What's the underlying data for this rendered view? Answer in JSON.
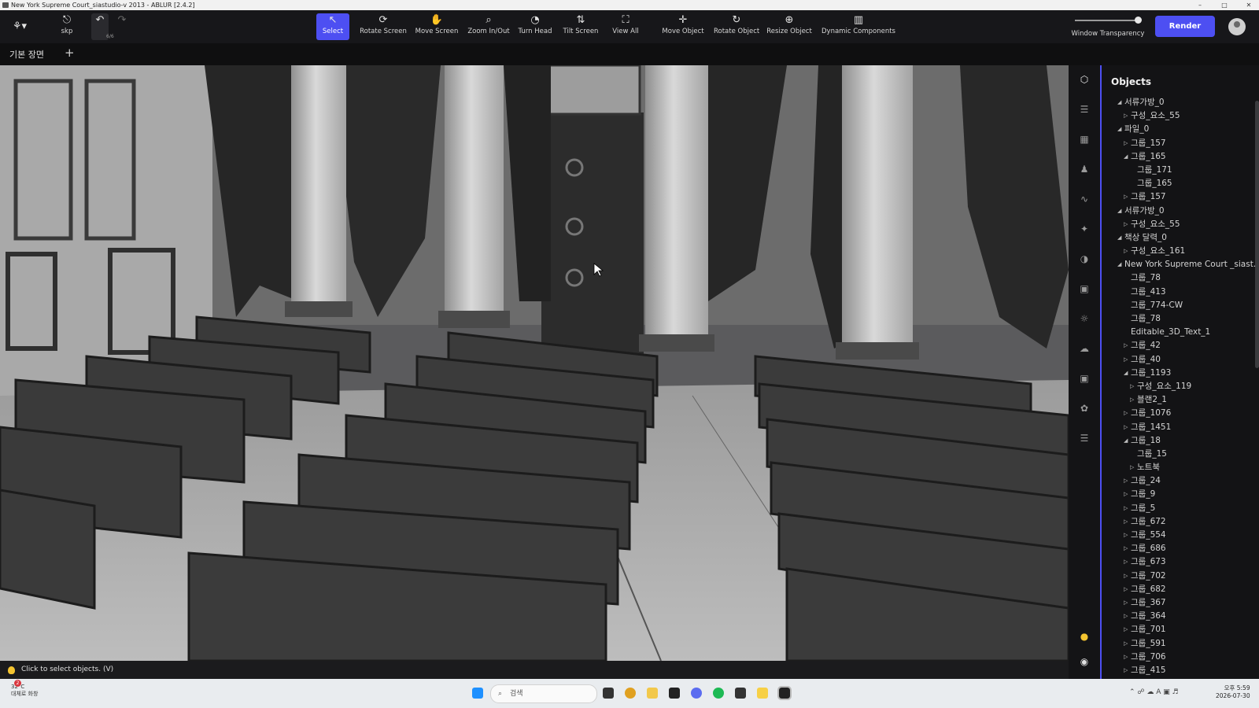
{
  "window": {
    "title": "New York Supreme Court_siastudio-v 2013 - ABLUR [2.4.2]",
    "controls": [
      "–",
      "□",
      "✕"
    ]
  },
  "toolbar": {
    "file_label": "skp",
    "undo_count": "6/6",
    "tools": [
      {
        "label": "Select",
        "icon": "↖",
        "icon_name": "cursor-icon",
        "active": true
      },
      {
        "label": "Rotate Screen",
        "icon": "⟳",
        "icon_name": "rotate-screen-icon"
      },
      {
        "label": "Move Screen",
        "icon": "✋",
        "icon_name": "hand-icon"
      },
      {
        "label": "Zoom In/Out",
        "icon": "⌕",
        "icon_name": "zoom-icon"
      },
      {
        "label": "Turn Head",
        "icon": "◔",
        "icon_name": "turn-head-icon"
      },
      {
        "label": "Tilt Screen",
        "icon": "⇅",
        "icon_name": "tilt-icon"
      },
      {
        "label": "View All",
        "icon": "⛶",
        "icon_name": "view-all-icon"
      },
      {
        "label": "Move Object",
        "icon": "✛",
        "icon_name": "move-object-icon"
      },
      {
        "label": "Rotate Object",
        "icon": "↻",
        "icon_name": "rotate-object-icon"
      },
      {
        "label": "Resize Object",
        "icon": "⊕",
        "icon_name": "resize-object-icon"
      },
      {
        "label": "Dynamic Components",
        "icon": "▥",
        "icon_name": "dynamic-components-icon"
      }
    ],
    "transparency_label": "Window Transparency",
    "transparency_value": 0.95,
    "render_label": "Render"
  },
  "scenes": {
    "tab_label": "기본 장면",
    "add_label": "+"
  },
  "status": {
    "hint": "Click to select objects. (V)"
  },
  "panel": {
    "title": "Objects",
    "items": [
      {
        "label": "서류가방_0",
        "depth": 0,
        "state": "open"
      },
      {
        "label": "구성_요소_55",
        "depth": 1,
        "state": "closed"
      },
      {
        "label": "파일_0",
        "depth": 0,
        "state": "open"
      },
      {
        "label": "그룹_157",
        "depth": 1,
        "state": "closed"
      },
      {
        "label": "그룹_165",
        "depth": 1,
        "state": "open"
      },
      {
        "label": "그룹_171",
        "depth": 2,
        "state": "none"
      },
      {
        "label": "그룹_165",
        "depth": 2,
        "state": "none"
      },
      {
        "label": "그룹_157",
        "depth": 1,
        "state": "closed"
      },
      {
        "label": "서류가방_0",
        "depth": 0,
        "state": "open"
      },
      {
        "label": "구성_요소_55",
        "depth": 1,
        "state": "closed"
      },
      {
        "label": "책상 달력_0",
        "depth": 0,
        "state": "open"
      },
      {
        "label": "구성_요소_161",
        "depth": 1,
        "state": "closed"
      },
      {
        "label": "New York Supreme Court _siast...",
        "depth": 0,
        "state": "open"
      },
      {
        "label": "그룹_78",
        "depth": 1,
        "state": "none"
      },
      {
        "label": "그룹_413",
        "depth": 1,
        "state": "none"
      },
      {
        "label": "그룹_774-CW",
        "depth": 1,
        "state": "none"
      },
      {
        "label": "그룹_78",
        "depth": 1,
        "state": "none"
      },
      {
        "label": "Editable_3D_Text_1",
        "depth": 1,
        "state": "none"
      },
      {
        "label": "그룹_42",
        "depth": 1,
        "state": "closed"
      },
      {
        "label": "그룹_40",
        "depth": 1,
        "state": "closed"
      },
      {
        "label": "그룹_1193",
        "depth": 1,
        "state": "open"
      },
      {
        "label": "구성_요소_119",
        "depth": 2,
        "state": "closed"
      },
      {
        "label": "블랜2_1",
        "depth": 2,
        "state": "closed"
      },
      {
        "label": "그룹_1076",
        "depth": 1,
        "state": "closed"
      },
      {
        "label": "그룹_1451",
        "depth": 1,
        "state": "closed"
      },
      {
        "label": "그룹_18",
        "depth": 1,
        "state": "open"
      },
      {
        "label": "그룹_15",
        "depth": 2,
        "state": "none"
      },
      {
        "label": "노트북",
        "depth": 2,
        "state": "closed"
      },
      {
        "label": "그룹_24",
        "depth": 1,
        "state": "closed"
      },
      {
        "label": "그룹_9",
        "depth": 1,
        "state": "closed"
      },
      {
        "label": "그룹_5",
        "depth": 1,
        "state": "closed"
      },
      {
        "label": "그룹_672",
        "depth": 1,
        "state": "closed"
      },
      {
        "label": "그룹_554",
        "depth": 1,
        "state": "closed"
      },
      {
        "label": "그룹_686",
        "depth": 1,
        "state": "closed"
      },
      {
        "label": "그룹_673",
        "depth": 1,
        "state": "closed"
      },
      {
        "label": "그룹_702",
        "depth": 1,
        "state": "closed"
      },
      {
        "label": "그룹_682",
        "depth": 1,
        "state": "closed"
      },
      {
        "label": "그룹_367",
        "depth": 1,
        "state": "closed"
      },
      {
        "label": "그룹_364",
        "depth": 1,
        "state": "closed"
      },
      {
        "label": "그룹_701",
        "depth": 1,
        "state": "closed"
      },
      {
        "label": "그룹_591",
        "depth": 1,
        "state": "closed"
      },
      {
        "label": "그룹_706",
        "depth": 1,
        "state": "closed"
      },
      {
        "label": "그룹_415",
        "depth": 1,
        "state": "closed"
      }
    ]
  },
  "taskbar": {
    "weather_temp": "32°C",
    "weather_desc": "대체로 화창",
    "notification_count": "2",
    "search_placeholder": "검색",
    "time": "오후 5:59",
    "date": "2026-07-30"
  },
  "colors": {
    "accent": "#4d4ff2",
    "toolbar_bg": "#17171a",
    "panel_bg": "#131315"
  }
}
